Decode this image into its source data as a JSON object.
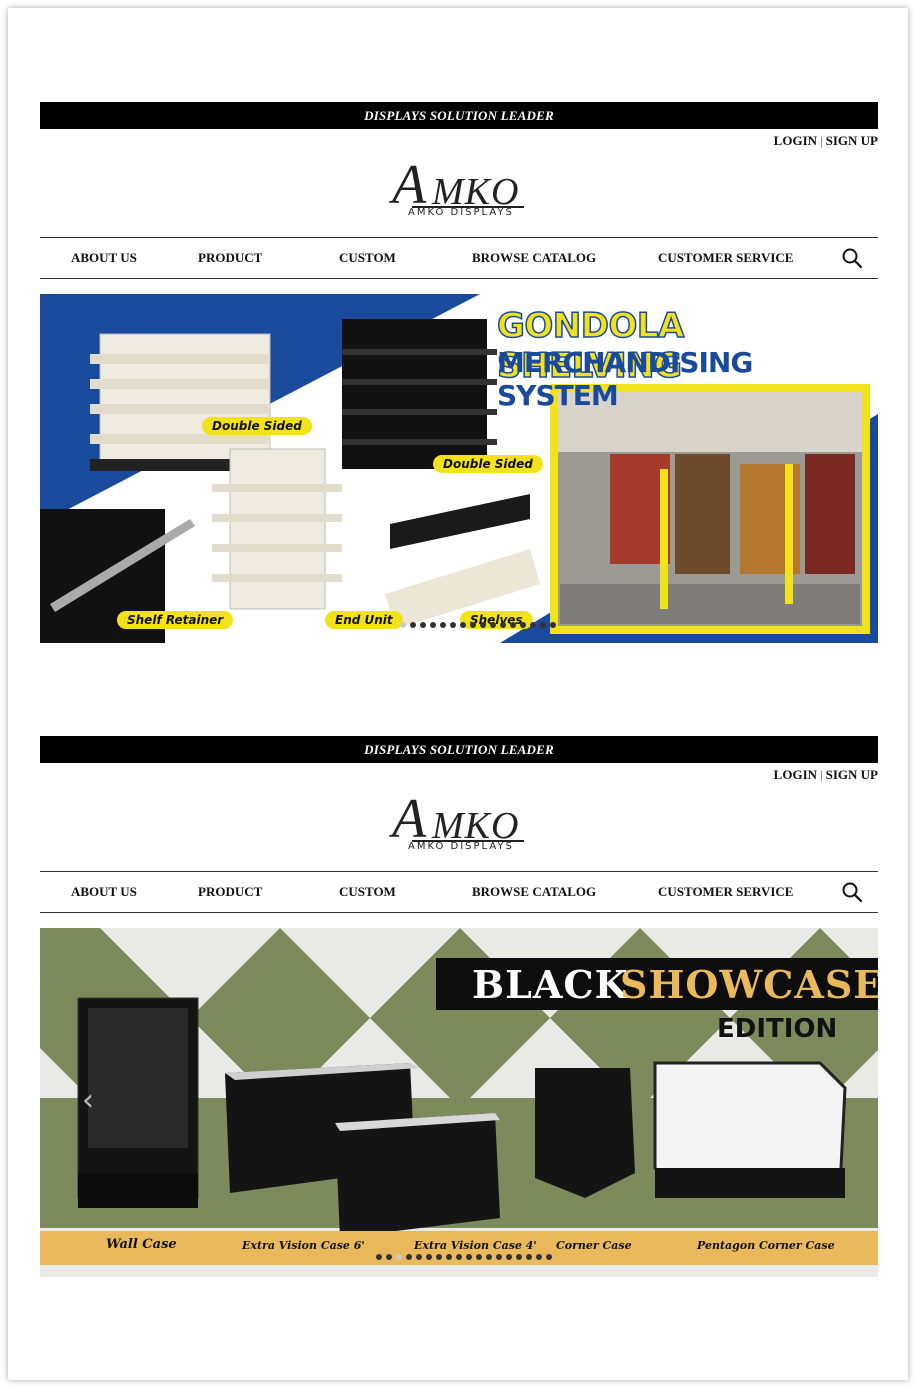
{
  "sections": [
    {
      "topbar": "DISPLAYS SOLUTION LEADER",
      "auth": {
        "login": "LOGIN",
        "separator": "|",
        "signup": "SIGN UP"
      },
      "logo": {
        "big": "A",
        "rest": "MKO",
        "sub": "AMKO DISPLAYS"
      },
      "nav": [
        "ABOUT US",
        "PRODUCT",
        "CUSTOM",
        "BROWSE CATALOG",
        "CUSTOMER SERVICE"
      ],
      "banner": {
        "title_line1": "GONDOLA SHELVING",
        "title_line2": "MERCHANDISING SYSTEM",
        "labels": [
          "Double Sided",
          "Double Sided",
          "Shelf Retainer",
          "End Unit",
          "Shelves"
        ]
      }
    },
    {
      "topbar": "DISPLAYS SOLUTION LEADER",
      "auth": {
        "login": "LOGIN",
        "separator": "|",
        "signup": "SIGN UP"
      },
      "logo": {
        "big": "A",
        "rest": "MKO",
        "sub": "AMKO DISPLAYS"
      },
      "nav": [
        "ABOUT US",
        "PRODUCT",
        "CUSTOM",
        "BROWSE CATALOG",
        "CUSTOMER SERVICE"
      ],
      "banner": {
        "title_black": "BLACK",
        "title_gold": "SHOWCASE",
        "subtitle": "EDITION",
        "labels": [
          "Wall Case",
          "Extra Vision Case 6'",
          "Extra Vision Case 4'",
          "Corner Case",
          "Pentagon Corner Case"
        ]
      }
    }
  ],
  "carousel": {
    "dot_count": 18,
    "active_index_banner1": 0,
    "active_index_banner2": 2
  },
  "colors": {
    "topbar": "#000000",
    "gondola_blue": "#1a4a9c",
    "gondola_yellow": "#f2e21c",
    "showcase_green": "#7d8a5c",
    "showcase_gold": "#e9b95c"
  }
}
